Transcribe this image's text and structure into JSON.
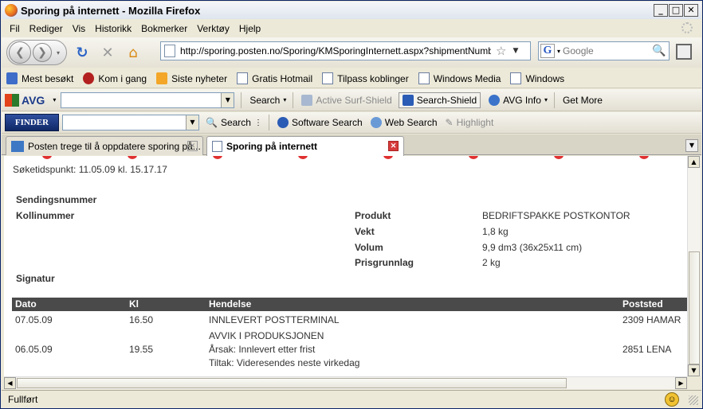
{
  "window": {
    "title": "Sporing på internett - Mozilla Firefox"
  },
  "menu": [
    "Fil",
    "Rediger",
    "Vis",
    "Historikk",
    "Bokmerker",
    "Verktøy",
    "Hjelp"
  ],
  "nav": {
    "url": "http://sporing.posten.no/Sporing/KMSporingInternett.aspx?shipmentNumber=CK",
    "search_placeholder": "Google"
  },
  "bookmarks": [
    "Mest besøkt",
    "Kom i gang",
    "Siste nyheter",
    "Gratis Hotmail",
    "Tilpass koblinger",
    "Windows Media",
    "Windows"
  ],
  "avg_toolbar": {
    "logo": "AVG",
    "search": "Search",
    "active_surf_shield": "Active Surf-Shield",
    "search_shield": "Search-Shield",
    "avg_info": "AVG Info",
    "get_more": "Get More"
  },
  "finder_toolbar": {
    "logo": "FINDER",
    "search": "Search",
    "software_search": "Software Search",
    "web_search": "Web Search",
    "highlight": "Highlight"
  },
  "tabs": [
    {
      "label": "Posten trege til å oppdatere sporing på...",
      "active": false
    },
    {
      "label": "Sporing på internett",
      "active": true
    }
  ],
  "page": {
    "search_time": "Søketidspunkt: 11.05.09 kl. 15.17.17",
    "sendingsnummer_label": "Sendingsnummer",
    "kollinummer_label": "Kollinummer",
    "signatur_label": "Signatur",
    "details": [
      {
        "label": "Produkt",
        "value": "BEDRIFTSPAKKE POSTKONTOR"
      },
      {
        "label": "Vekt",
        "value": "1,8 kg"
      },
      {
        "label": "Volum",
        "value": "9,9 dm3 (36x25x11 cm)"
      },
      {
        "label": "Prisgrunnlag",
        "value": "2 kg"
      }
    ],
    "table": {
      "headers": [
        "Dato",
        "Kl",
        "Hendelse",
        "Poststed"
      ],
      "rows": [
        {
          "dato": "07.05.09",
          "kl": "16.50",
          "hendelse": [
            "INNLEVERT POSTTERMINAL"
          ],
          "poststed": "2309 HAMAR"
        },
        {
          "dato": "06.05.09",
          "kl": "19.55",
          "hendelse": [
            "AVVIK I PRODUKSJONEN",
            "Årsak: Innlevert etter frist",
            "Tiltak: Videresendes neste virkedag"
          ],
          "poststed": "2851 LENA"
        }
      ]
    }
  },
  "status": {
    "text": "Fullført"
  }
}
